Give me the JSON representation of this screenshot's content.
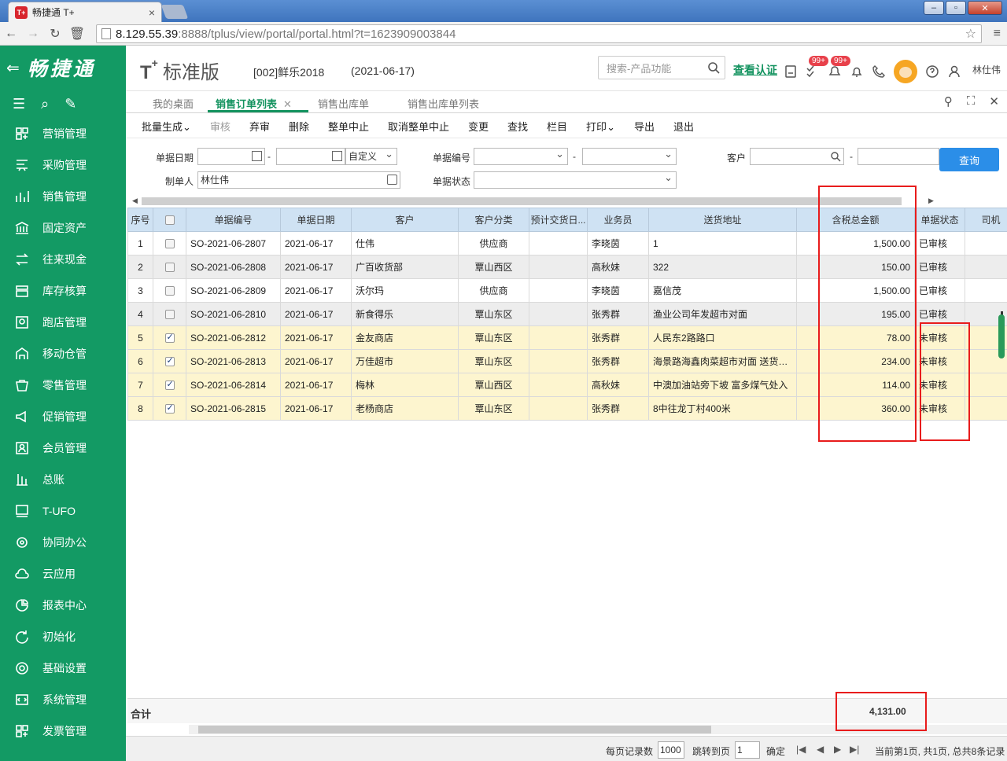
{
  "browser": {
    "tab_title": "畅捷通 T+",
    "favicon": "T+",
    "url_host": "8.129.55.39",
    "url_rest": ":8888/tplus/view/portal/portal.html?t=1623909003844"
  },
  "sidebar": {
    "brand": "畅捷通",
    "items": [
      {
        "label": "营销管理",
        "icon": "marketing-icon"
      },
      {
        "label": "采购管理",
        "icon": "purchase-icon"
      },
      {
        "label": "销售管理",
        "icon": "sales-icon"
      },
      {
        "label": "固定资产",
        "icon": "bank-icon"
      },
      {
        "label": "往来现金",
        "icon": "exchange-icon"
      },
      {
        "label": "库存核算",
        "icon": "inventory-icon"
      },
      {
        "label": "跑店管理",
        "icon": "store-visit-icon"
      },
      {
        "label": "移动仓管",
        "icon": "mobile-warehouse-icon"
      },
      {
        "label": "零售管理",
        "icon": "retail-icon"
      },
      {
        "label": "促销管理",
        "icon": "promotion-icon"
      },
      {
        "label": "会员管理",
        "icon": "member-icon"
      },
      {
        "label": "总账",
        "icon": "ledger-icon"
      },
      {
        "label": "T-UFO",
        "icon": "ufo-icon"
      },
      {
        "label": "协同办公",
        "icon": "collab-icon"
      },
      {
        "label": "云应用",
        "icon": "cloud-icon"
      },
      {
        "label": "报表中心",
        "icon": "report-icon"
      },
      {
        "label": "初始化",
        "icon": "init-icon"
      },
      {
        "label": "基础设置",
        "icon": "settings-icon"
      },
      {
        "label": "系统管理",
        "icon": "system-icon"
      },
      {
        "label": "发票管理",
        "icon": "invoice-icon"
      }
    ]
  },
  "header": {
    "logo_mark": "T",
    "logo_plus": "+",
    "edition": "标准版",
    "account": "[002]鲜乐2018",
    "date": "(2021-06-17)",
    "search_placeholder": "搜索-产品功能",
    "verify_link": "查看认证",
    "badge_1": "99+",
    "badge_2": "99+",
    "user": "林仕伟"
  },
  "tabs": [
    {
      "label": "我的桌面"
    },
    {
      "label": "销售订单列表",
      "active": true
    },
    {
      "label": "销售出库单"
    },
    {
      "label": "销售出库单列表"
    }
  ],
  "actions": [
    {
      "label": "批量生成",
      "dropdown": true
    },
    {
      "label": "审核",
      "disabled": true
    },
    {
      "label": "弃审"
    },
    {
      "label": "删除"
    },
    {
      "label": "整单中止"
    },
    {
      "label": "取消整单中止"
    },
    {
      "label": "变更"
    },
    {
      "label": "查找"
    },
    {
      "label": "栏目"
    },
    {
      "label": "打印",
      "dropdown": true
    },
    {
      "label": "导出"
    },
    {
      "label": "退出"
    }
  ],
  "filters": {
    "date_label": "单据日期",
    "date_mode": "自定义",
    "code_label": "单据编号",
    "customer_label": "客户",
    "maker_label": "制单人",
    "maker_value": "林仕伟",
    "status_label": "单据状态",
    "query_button": "查询"
  },
  "grid": {
    "columns": [
      "序号",
      "",
      "单据编号",
      "单据日期",
      "客户",
      "客户分类",
      "预计交货日...",
      "业务员",
      "送货地址",
      "含税总金额",
      "单据状态",
      "司机"
    ],
    "rows": [
      {
        "no": "1",
        "checked": false,
        "code": "SO-2021-06-2807",
        "date": "2021-06-17",
        "customer": "仕伟",
        "category": "供应商",
        "delivery": "",
        "salesman": "李晓茵",
        "address": "1",
        "amount": "1,500.00",
        "status": "已审核"
      },
      {
        "no": "2",
        "checked": false,
        "code": "SO-2021-06-2808",
        "date": "2021-06-17",
        "customer": "广百收货部",
        "category": "覃山西区",
        "delivery": "",
        "salesman": "高秋妹",
        "address": "322",
        "amount": "150.00",
        "status": "已审核"
      },
      {
        "no": "3",
        "checked": false,
        "code": "SO-2021-06-2809",
        "date": "2021-06-17",
        "customer": "沃尔玛",
        "category": "供应商",
        "delivery": "",
        "salesman": "李晓茵",
        "address": "嘉信茂",
        "amount": "1,500.00",
        "status": "已审核"
      },
      {
        "no": "4",
        "checked": false,
        "code": "SO-2021-06-2810",
        "date": "2021-06-17",
        "customer": "新食得乐",
        "category": "覃山东区",
        "delivery": "",
        "salesman": "张秀群",
        "address": "渔业公司年发超市对面",
        "amount": "195.00",
        "status": "已审核"
      },
      {
        "no": "5",
        "checked": true,
        "code": "SO-2021-06-2812",
        "date": "2021-06-17",
        "customer": "金友商店",
        "category": "覃山东区",
        "delivery": "",
        "salesman": "张秀群",
        "address": "人民东2路路口",
        "amount": "78.00",
        "status": "未审核"
      },
      {
        "no": "6",
        "checked": true,
        "code": "SO-2021-06-2813",
        "date": "2021-06-17",
        "customer": "万佳超市",
        "category": "覃山东区",
        "delivery": "",
        "salesman": "张秀群",
        "address": "海景路海鑫肉菜超市对面 送货…",
        "amount": "234.00",
        "status": "未审核"
      },
      {
        "no": "7",
        "checked": true,
        "code": "SO-2021-06-2814",
        "date": "2021-06-17",
        "customer": "梅林",
        "category": "覃山西区",
        "delivery": "",
        "salesman": "高秋妹",
        "address": "中澳加油站旁下坡 富多煤气处入",
        "amount": "114.00",
        "status": "未审核"
      },
      {
        "no": "8",
        "checked": true,
        "code": "SO-2021-06-2815",
        "date": "2021-06-17",
        "customer": "老杨商店",
        "category": "覃山东区",
        "delivery": "",
        "salesman": "张秀群",
        "address": "8中往龙丁村400米",
        "amount": "360.00",
        "status": "未审核"
      }
    ],
    "total_label": "合计",
    "total_amount": "4,131.00"
  },
  "pager": {
    "per_page_label": "每页记录数",
    "per_page": "1000",
    "jump_label": "跳转到页",
    "jump_page": "1",
    "confirm": "确定",
    "summary": "当前第1页, 共1页, 总共8条记录"
  },
  "colors": {
    "sidebar": "#139a64",
    "accent": "#13935f",
    "header_row": "#cfe2f3",
    "checked_row": "#fdf5cf",
    "query": "#2b8ee8",
    "annotation": "#e81c1c"
  }
}
